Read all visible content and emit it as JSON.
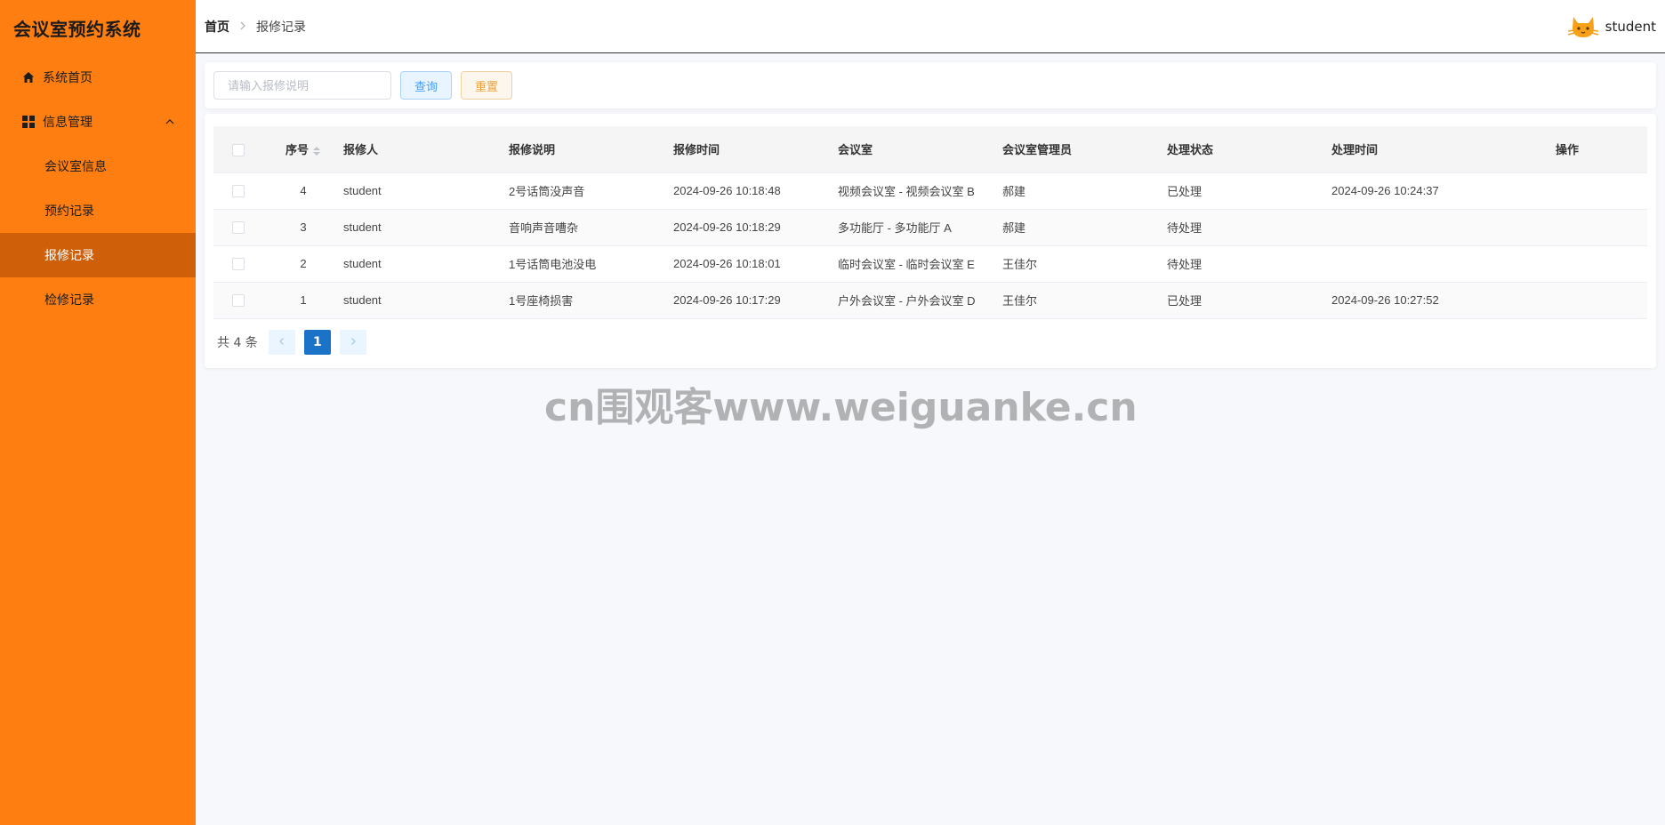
{
  "app": {
    "title": "会议室预约系统"
  },
  "sidebar": {
    "items": [
      {
        "label": "系统首页",
        "icon": "home-icon"
      },
      {
        "label": "信息管理",
        "icon": "grid-icon",
        "expanded": true,
        "children": [
          {
            "label": "会议室信息"
          },
          {
            "label": "预约记录"
          },
          {
            "label": "报修记录",
            "active": true
          },
          {
            "label": "检修记录"
          }
        ]
      }
    ]
  },
  "header": {
    "breadcrumb": {
      "home": "首页",
      "current": "报修记录"
    },
    "user": {
      "name": "student",
      "avatar_icon": "cat-icon"
    }
  },
  "search": {
    "placeholder": "请输入报修说明",
    "value": "",
    "query_label": "查询",
    "reset_label": "重置"
  },
  "table": {
    "columns": [
      "序号",
      "报修人",
      "报修说明",
      "报修时间",
      "会议室",
      "会议室管理员",
      "处理状态",
      "处理时间",
      "操作"
    ],
    "rows": [
      {
        "id": "4",
        "reporter": "student",
        "desc": "2号话筒没声音",
        "time": "2024-09-26 10:18:48",
        "room": "视频会议室 - 视频会议室 B",
        "admin": "郝建",
        "status": "已处理",
        "handled_time": "2024-09-26 10:24:37"
      },
      {
        "id": "3",
        "reporter": "student",
        "desc": "音响声音嘈杂",
        "time": "2024-09-26 10:18:29",
        "room": "多功能厅 - 多功能厅 A",
        "admin": "郝建",
        "status": "待处理",
        "handled_time": ""
      },
      {
        "id": "2",
        "reporter": "student",
        "desc": "1号话筒电池没电",
        "time": "2024-09-26 10:18:01",
        "room": "临时会议室 - 临时会议室 E",
        "admin": "王佳尔",
        "status": "待处理",
        "handled_time": ""
      },
      {
        "id": "1",
        "reporter": "student",
        "desc": "1号座椅损害",
        "time": "2024-09-26 10:17:29",
        "room": "户外会议室 - 户外会议室 D",
        "admin": "王佳尔",
        "status": "已处理",
        "handled_time": "2024-09-26 10:27:52"
      }
    ]
  },
  "pagination": {
    "total_text": "共 4 条",
    "current_page": "1"
  },
  "watermark": "cn围观客www.weiguanke.cn",
  "colors": {
    "sidebar": "#fe7e11",
    "sidebar_active": "#cf5f09",
    "page_bg": "#f7f8fc",
    "pager_active": "#1a73c6"
  }
}
